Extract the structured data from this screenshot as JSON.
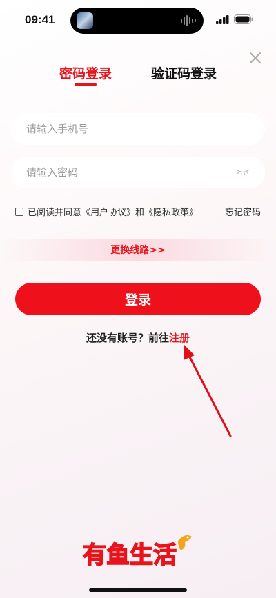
{
  "status": {
    "time": "09:41"
  },
  "tabs": {
    "password_login": "密码登录",
    "code_login": "验证码登录"
  },
  "form": {
    "phone_placeholder": "请输入手机号",
    "password_placeholder": "请输入密码"
  },
  "agreement": {
    "prefix": "已阅读并同意",
    "user_agreement": "《用户协议》",
    "and": "和",
    "privacy_policy": "《隐私政策》",
    "forgot_password": "忘记密码"
  },
  "switch_line": "更换线路>>",
  "login_button": "登录",
  "register": {
    "prompt": "还没有账号？前往",
    "link": "注册"
  },
  "logo_text": "有鱼生活",
  "colors": {
    "accent": "#e8141c",
    "button": "#ee101a"
  },
  "icons": [
    "close-icon",
    "eye-closed-icon",
    "signal-icon",
    "battery-icon",
    "fish-logo-icon"
  ]
}
